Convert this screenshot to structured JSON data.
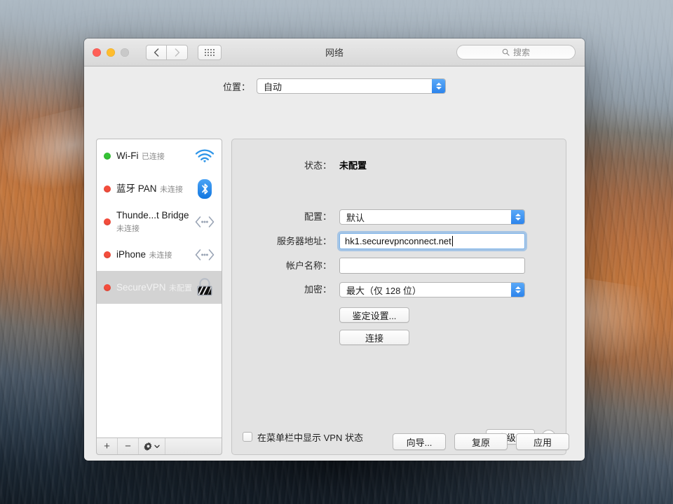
{
  "window": {
    "title": "网络",
    "traffic": {
      "close": "close-button",
      "minimize": "minimize-button",
      "zoom": "zoom-button"
    },
    "search_placeholder": "搜索"
  },
  "location": {
    "label": "位置：",
    "value": "自动"
  },
  "sidebar": {
    "services": [
      {
        "name": "Wi-Fi",
        "status": "已连接",
        "dot": "green",
        "icon": "wifi-icon",
        "selected": false
      },
      {
        "name": "蓝牙 PAN",
        "status": "未连接",
        "dot": "red",
        "icon": "bluetooth-icon",
        "selected": false
      },
      {
        "name": "Thunde...t Bridge",
        "status": "未连接",
        "dot": "red",
        "icon": "thunderbolt-icon",
        "selected": false
      },
      {
        "name": "iPhone",
        "status": "未连接",
        "dot": "red",
        "icon": "thunderbolt-icon",
        "selected": false
      },
      {
        "name": "SecureVPN",
        "status": "未配置",
        "dot": "red",
        "icon": "vpn-lock-icon",
        "selected": true
      }
    ],
    "toolbar": {
      "add": "+",
      "remove": "−",
      "gear": "⚙"
    }
  },
  "detail": {
    "status_label": "状态：",
    "status_value": "未配置",
    "config_label": "配置：",
    "config_value": "默认",
    "server_label": "服务器地址：",
    "server_value": "hk1.securevpnconnect.net",
    "account_label": "帐户名称：",
    "account_value": "",
    "encryption_label": "加密：",
    "encryption_value": "最大（仅 128 位）",
    "auth_settings_button": "鉴定设置...",
    "connect_button": "连接",
    "show_vpn_status_label": "在菜单栏中显示 VPN 状态",
    "advanced_button": "高级...",
    "help_button": "?"
  },
  "actions": {
    "assistant": "向导...",
    "revert": "复原",
    "apply": "应用"
  },
  "colors": {
    "accent_blue": "#2c84ec",
    "status_connected": "#35c335",
    "status_disconnected": "#f44d3c",
    "focus_ring": "#7cb2e8"
  }
}
